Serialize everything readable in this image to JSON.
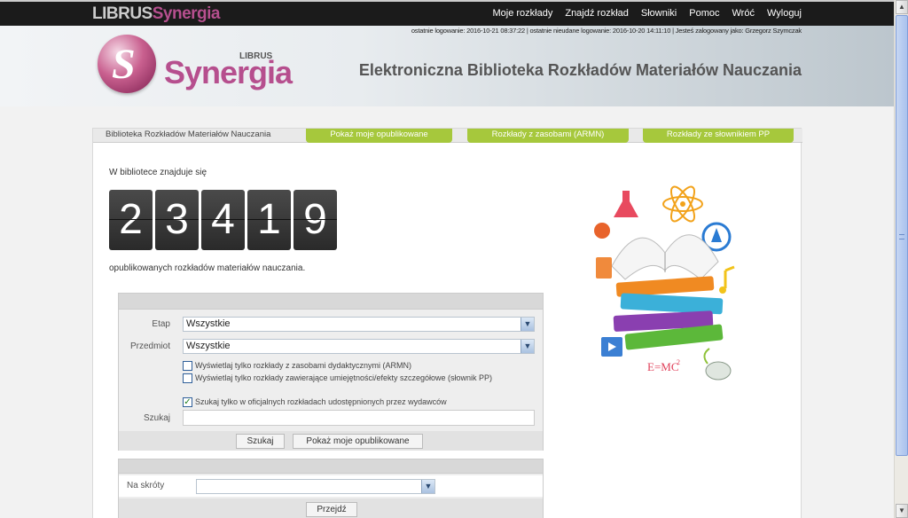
{
  "topbar": {
    "brand_libris": "LIBRUS",
    "brand_synergia": "Synergia",
    "nav": [
      "Moje rozkłady",
      "Znajdź rozkład",
      "Słowniki",
      "Pomoc",
      "Wróć",
      "Wyloguj"
    ]
  },
  "header": {
    "login_info": "ostatnie logowanie: 2016-10-21 08:37:22  |  ostatnie nieudane logowanie: 2016-10-20 14:11:10  |  Jesteś zalogowany jako: Grzegorz Szymczak",
    "logo_libris": "LIBRUS",
    "logo_synergia": "Synergia",
    "title": "Elektroniczna Biblioteka Rozkładów Materiałów Nauczania"
  },
  "tabs": {
    "active": "Biblioteka Rozkładów Materiałów Nauczania",
    "items": [
      "Pokaż moje opublikowane",
      "Rozkłady z zasobami (ARMN)",
      "Rozkłady ze słownikiem PP"
    ]
  },
  "library": {
    "intro": "W bibliotece znajduje się",
    "digits": [
      "2",
      "3",
      "4",
      "1",
      "9"
    ],
    "outro": "opublikowanych rozkładów materiałów nauczania."
  },
  "form": {
    "etap_label": "Etap",
    "etap_value": "Wszystkie",
    "przedmiot_label": "Przedmiot",
    "przedmiot_value": "Wszystkie",
    "check1": "Wyświetlaj tylko rozkłady z zasobami dydaktycznymi (ARMN)",
    "check2": "Wyświetlaj tylko rozkłady zawierające umiejętności/efekty szczegółowe (słownik PP)",
    "check3": "Szukaj tylko w oficjalnych rozkładach udostępnionych przez wydawców",
    "search_label": "Szukaj",
    "search_button": "Szukaj",
    "show_mine_button": "Pokaż moje opublikowane"
  },
  "shortcuts": {
    "label": "Na skróty",
    "go_button": "Przejdź"
  },
  "illustration": {
    "formula": "E=MC"
  },
  "colors": {
    "accent_green": "#a6c83c",
    "brand_pink": "#b64f8e"
  }
}
